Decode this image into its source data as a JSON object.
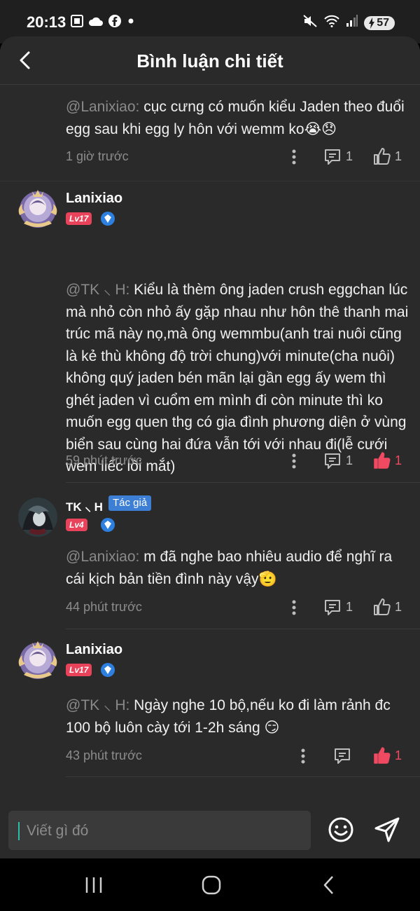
{
  "status_bar": {
    "time": "20:13",
    "battery": "57",
    "icons": [
      "screenshot-icon",
      "cloud-icon",
      "facebook-icon",
      "dot-icon",
      "mute-icon",
      "wifi-icon",
      "signal-icon"
    ]
  },
  "header": {
    "title": "Bình luận chi tiết"
  },
  "comments": [
    {
      "mention": "@Lanixiao:",
      "text": " cục cưng có muốn kiểu Jaden theo đuổi egg sau khi egg ly hôn với wemm ko😭😞",
      "time": "1 giờ trước",
      "reply_count": "1",
      "like_count": "1",
      "liked": false
    },
    {
      "author": "Lanixiao",
      "level": "Lv17",
      "mention": "@TK ⸜ H:",
      "text": " Kiểu là thèm ông jaden crush eggchan lúc mà nhỏ còn nhỏ ấy gặp nhau như hôn thê thanh mai trúc mã này nọ,mà ông wemmbu(anh trai nuôi cũng là kẻ thù không độ trời chung)với minute(cha nuôi) không quý jaden bén mãn lại gần egg ấy wem thì ghét jaden vì cuổm em mình đi còn minute thì ko muốn egg quen thg có gia đình phương diện ở vùng biển sau cùng hai đứa vẫn tới với nhau đi(lễ cưới wem liếc lồi mắt)",
      "time": "59 phút trước",
      "reply_count": "1",
      "like_count": "1",
      "liked": true
    },
    {
      "author": "TK ⸜ H",
      "author_tag": "Tác giả",
      "level": "Lv4",
      "mention": "@Lanixiao:",
      "text": " m đã nghe bao nhiêu audio để nghĩ ra cái kịch bản tiền đình này vậy🫡",
      "time": "44 phút trước",
      "reply_count": "1",
      "like_count": "1",
      "liked": false
    },
    {
      "author": "Lanixiao",
      "level": "Lv17",
      "mention": "@TK ⸜ H:",
      "text": " Ngày nghe 10 bộ,nếu ko đi làm rảnh đc 100 bộ luôn cày tới 1-2h sáng 😏",
      "time": "43 phút trước",
      "like_count": "1",
      "liked": true
    }
  ],
  "input": {
    "placeholder": "Viết gì đó"
  },
  "colors": {
    "background": "#2a2a2a",
    "accent_like": "#ef4a61",
    "level_badge": "#e8435a",
    "author_tag": "#3d7fd4",
    "vip_badge": "#2d7fe0"
  }
}
